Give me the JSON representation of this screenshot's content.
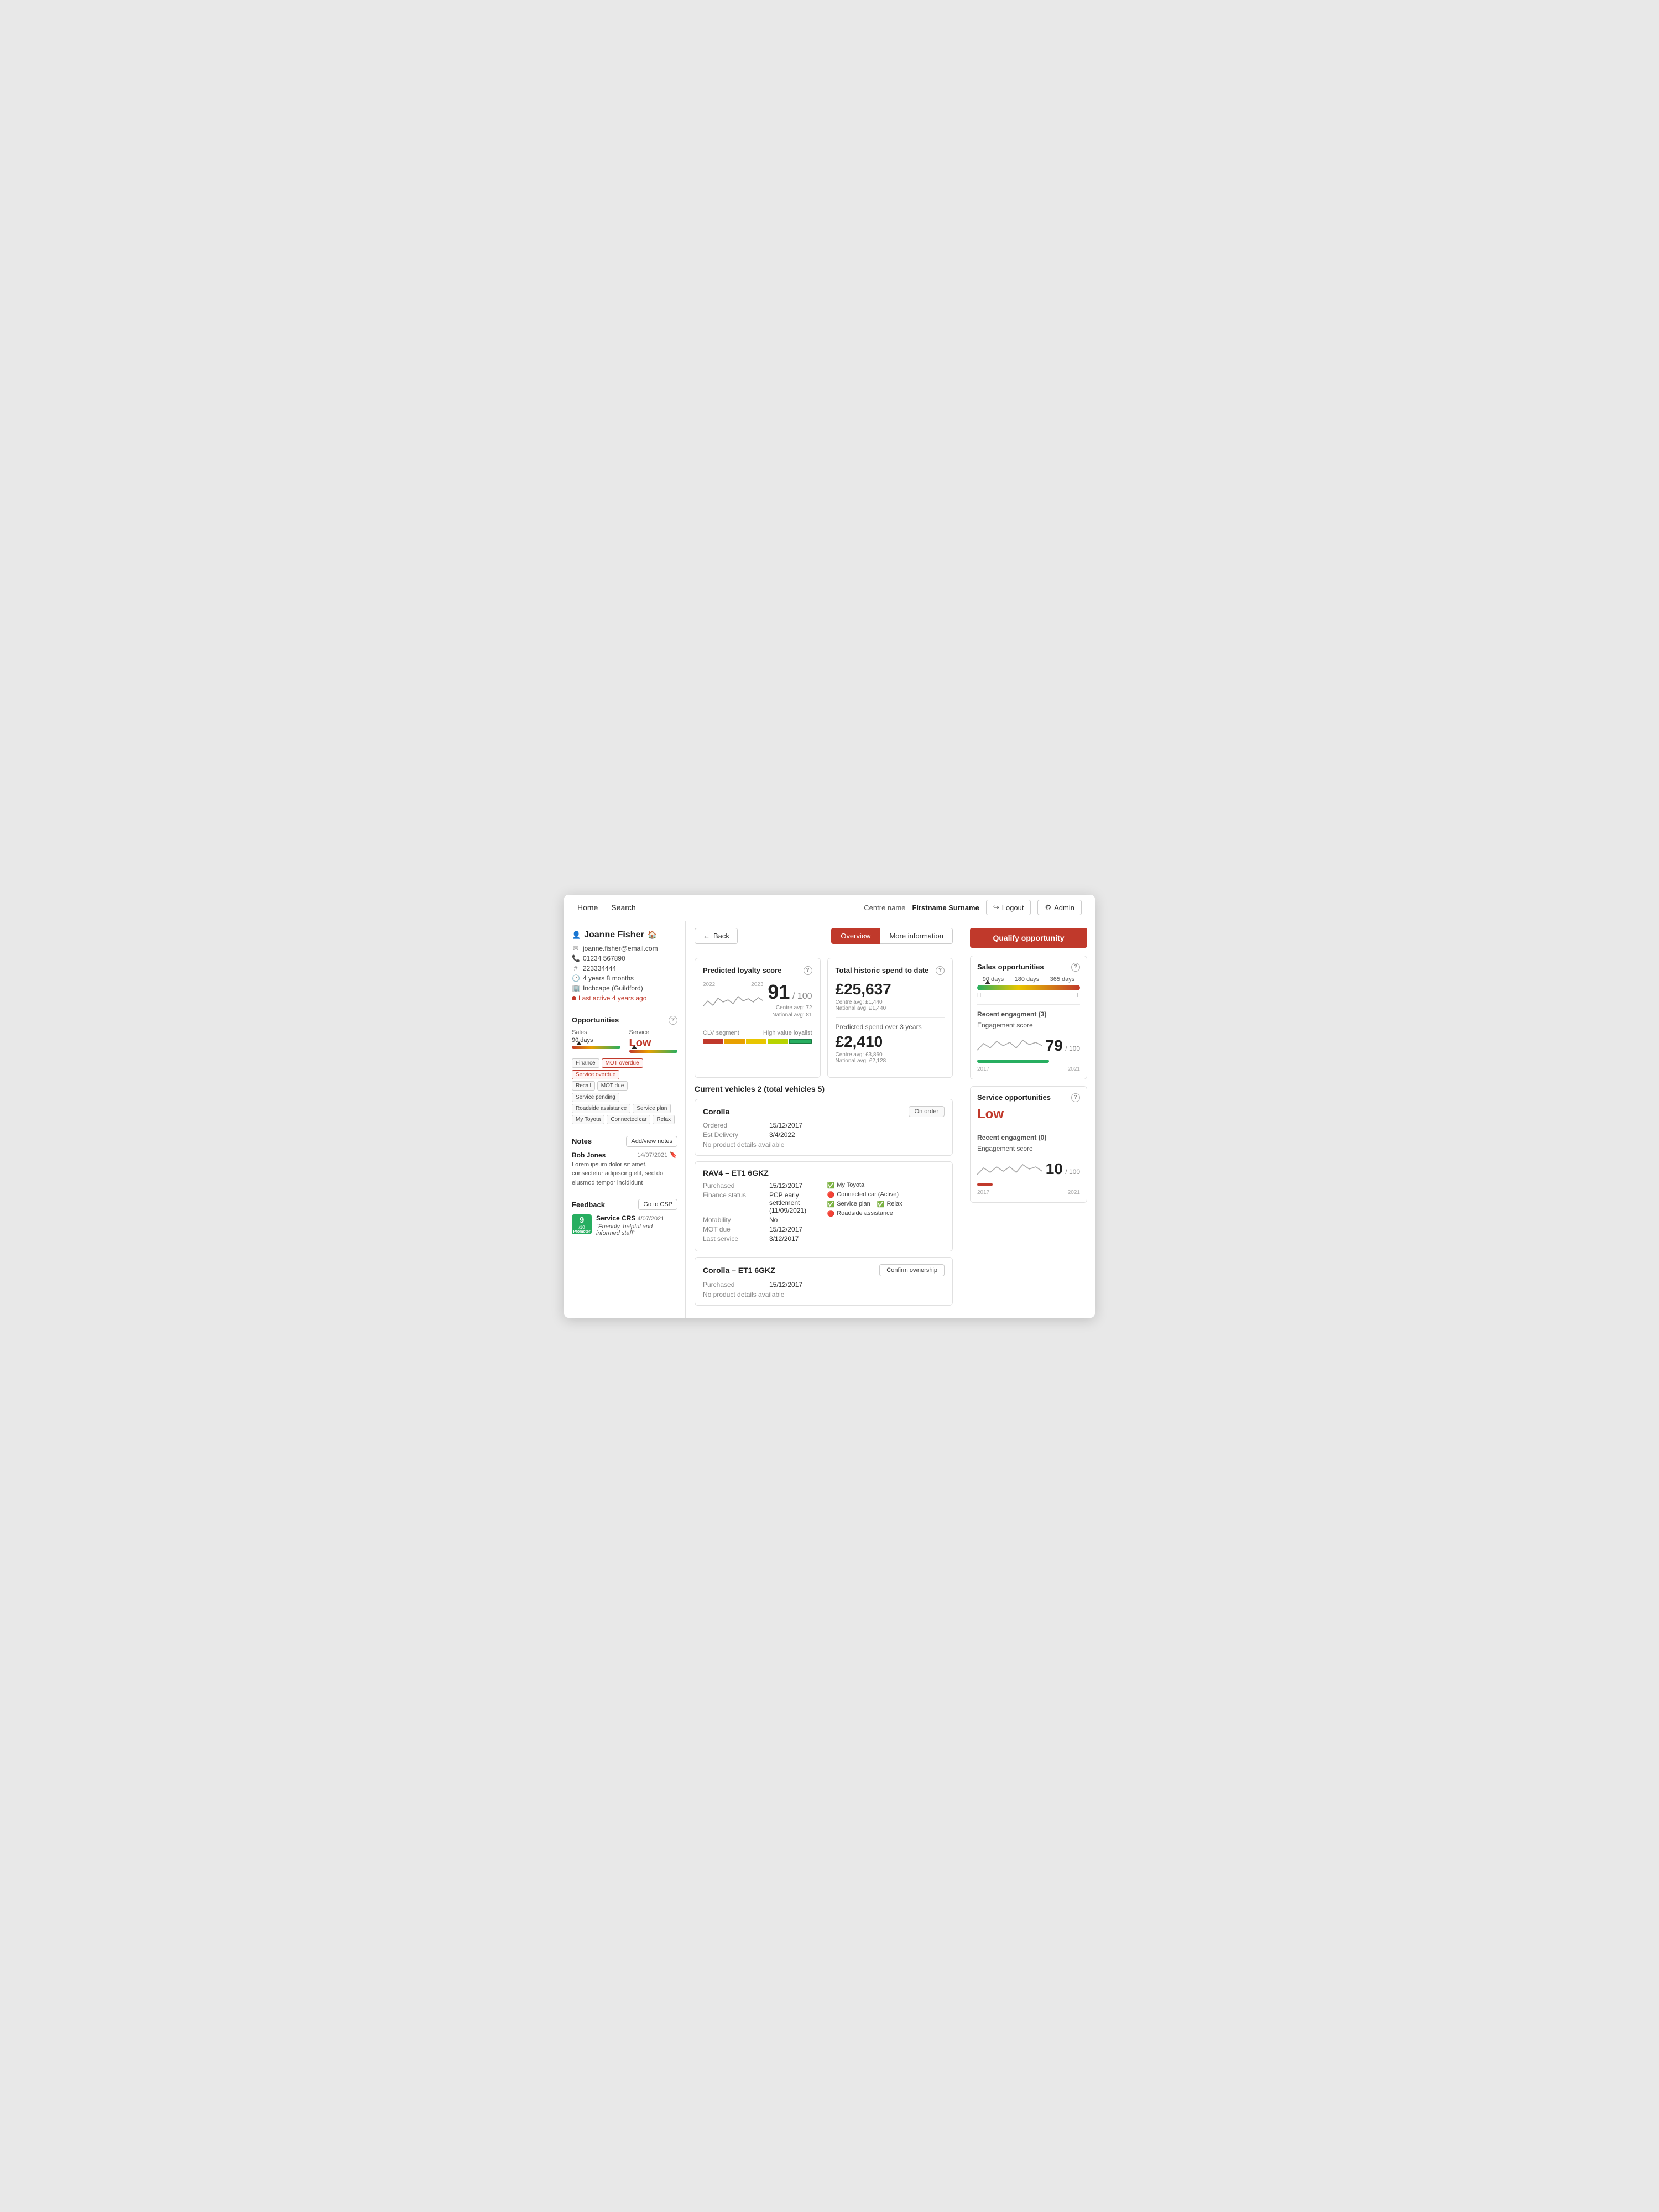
{
  "nav": {
    "home_label": "Home",
    "search_label": "Search",
    "centre_label": "Centre name",
    "username": "Firstname Surname",
    "logout_label": "Logout",
    "admin_label": "Admin"
  },
  "sidebar": {
    "name": "Joanne Fisher",
    "email": "joanne.fisher@email.com",
    "phone": "01234 567890",
    "customer_id": "223334444",
    "tenure": "4 years 8 months",
    "location": "Inchcape (Guildford)",
    "last_active": "Last active 4 years ago",
    "opportunities_label": "Opportunities",
    "sales_label": "Sales",
    "service_label": "Service",
    "sales_days": "90 days",
    "service_level": "Low",
    "tags": [
      {
        "label": "Finance",
        "type": "normal"
      },
      {
        "label": "MOT overdue",
        "type": "red"
      },
      {
        "label": "Service overdue",
        "type": "red"
      },
      {
        "label": "Recall",
        "type": "normal"
      },
      {
        "label": "MOT due",
        "type": "normal"
      },
      {
        "label": "Service pending",
        "type": "normal"
      },
      {
        "label": "Roadside assistance",
        "type": "normal"
      },
      {
        "label": "Service plan",
        "type": "normal"
      },
      {
        "label": "My Toyota",
        "type": "normal"
      },
      {
        "label": "Connected car",
        "type": "normal"
      },
      {
        "label": "Relax",
        "type": "normal"
      }
    ],
    "notes_label": "Notes",
    "add_notes_label": "Add/view notes",
    "note": {
      "author": "Bob Jones",
      "date": "14/07/2021",
      "text": "Lorem ipsum dolor sit amet, consectetur adipiscing elit, sed do eiusmod tempor incididunt"
    },
    "feedback_label": "Feedback",
    "go_csp_label": "Go to CSP",
    "feedback_score": "9",
    "feedback_score_denom": "/10",
    "feedback_promoter": "Promoter",
    "feedback_type": "Service CRS",
    "feedback_date": "4/07/2021",
    "feedback_quote": "\"Friendly, helpful and informed staff\""
  },
  "center": {
    "back_label": "Back",
    "tab_overview": "Overview",
    "tab_more_info": "More information",
    "loyalty_title": "Predicted loyalty score",
    "loyalty_score": "91",
    "loyalty_denom": "/ 100",
    "loyalty_centre_avg": "Centre avg: 72",
    "loyalty_national_avg": "National avg: 81",
    "loyalty_year_start": "2022",
    "loyalty_year_end": "2023",
    "clv_label": "CLV segment",
    "clv_high_label": "High value loyalist",
    "spend_title": "Total historic spend to date",
    "spend_amount": "£25,637",
    "spend_centre_avg": "Centre avg: £1,440",
    "spend_national_avg": "National avg: £1,440",
    "predicted_spend_label": "Predicted spend over 3 years",
    "predicted_amount": "£2,410",
    "predicted_centre_avg": "Centre avg: £3,860",
    "predicted_national_avg": "National avg: £2,128",
    "vehicles_title": "Current vehicles 2 (total vehicles 5)",
    "vehicles": [
      {
        "name": "Corolla",
        "badge": "On order",
        "rows": [
          {
            "label": "Ordered",
            "value": "15/12/2017"
          },
          {
            "label": "Est Delivery",
            "value": "3/4/2022"
          }
        ],
        "no_product": "No product details available",
        "confirm_btn": null
      },
      {
        "name": "RAV4 – ET1 6GKZ",
        "badge": null,
        "rows": [
          {
            "label": "Purchased",
            "value": "15/12/2017"
          },
          {
            "label": "Finance status",
            "value": "PCP early settlement (11/09/2021)"
          },
          {
            "label": "Motability",
            "value": "No"
          },
          {
            "label": "MOT due",
            "value": "15/12/2017"
          },
          {
            "label": "Last service",
            "value": "3/12/2017"
          }
        ],
        "products": [
          {
            "label": "My Toyota",
            "status": "green"
          },
          {
            "label": "Connected car (Active)",
            "status": "red"
          },
          {
            "label": "Service plan",
            "status": "green"
          },
          {
            "label": "Relax",
            "status": "green"
          },
          {
            "label": "Roadside assistance",
            "status": "red"
          }
        ],
        "confirm_btn": null
      },
      {
        "name": "Corolla – ET1 6GKZ",
        "badge": null,
        "rows": [
          {
            "label": "Purchased",
            "value": "15/12/2017"
          }
        ],
        "no_product": "No product details available",
        "confirm_btn": "Confirm ownership"
      }
    ]
  },
  "right": {
    "qualify_label": "Qualify opportunity",
    "sales_opp_title": "Sales opportunities",
    "days_labels": [
      "90 days",
      "180 days",
      "365 days"
    ],
    "hl_low": "H",
    "hl_high": "L",
    "engagement_title": "Recent engagment (3)",
    "engagement_score_label": "Engagement score",
    "engagement_score": "79",
    "engagement_denom": "/ 100",
    "eng_year_start": "2017",
    "eng_year_end": "2021",
    "service_opp_title": "Service opportunities",
    "service_level": "Low",
    "service_engagement_title": "Recent engagment (0)",
    "service_engagement_score_label": "Engagement score",
    "service_eng_score": "10",
    "service_eng_denom": "/ 100",
    "service_eng_year_start": "2017",
    "service_eng_year_end": "2021"
  }
}
